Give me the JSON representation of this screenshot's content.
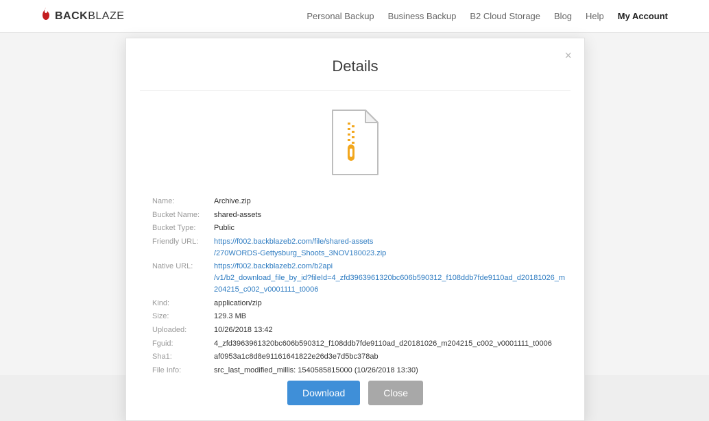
{
  "brand": {
    "bold": "BACK",
    "thin": "BLAZE"
  },
  "nav": {
    "items": [
      {
        "label": "Personal Backup"
      },
      {
        "label": "Business Backup"
      },
      {
        "label": "B2 Cloud Storage"
      },
      {
        "label": "Blog"
      },
      {
        "label": "Help"
      },
      {
        "label": "My Account"
      }
    ]
  },
  "modal": {
    "title": "Details",
    "labels": {
      "name": "Name:",
      "bucket_name": "Bucket Name:",
      "bucket_type": "Bucket Type:",
      "friendly_url": "Friendly URL:",
      "native_url": "Native URL:",
      "kind": "Kind:",
      "size": "Size:",
      "uploaded": "Uploaded:",
      "fguid": "Fguid:",
      "sha1": "Sha1:",
      "file_info": "File Info:"
    },
    "values": {
      "name": "Archive.zip",
      "bucket_name": "shared-assets",
      "bucket_type": "Public",
      "friendly_url_line1": "https://f002.backblazeb2.com/file/shared-assets",
      "friendly_url_line2": "/270WORDS-Gettysburg_Shoots_3NOV180023.zip",
      "native_url_line1": "https://f002.backblazeb2.com/b2api",
      "native_url_line2": "/v1/b2_download_file_by_id?fileId=4_zfd3963961320bc606b590312_f108ddb7fde9110ad_d20181026_m204215_c002_v0001111_t0006",
      "kind": "application/zip",
      "size": "129.3 MB",
      "uploaded": "10/26/2018 13:42",
      "fguid": "4_zfd3963961320bc606b590312_f108ddb7fde9110ad_d20181026_m204215_c002_v0001111_t0006",
      "sha1": "af0953a1c8d8e91161641822e26d3e7d5bc378ab",
      "file_info": "src_last_modified_millis: 1540585815000   (10/26/2018 13:30)"
    },
    "buttons": {
      "download": "Download",
      "close": "Close"
    }
  }
}
